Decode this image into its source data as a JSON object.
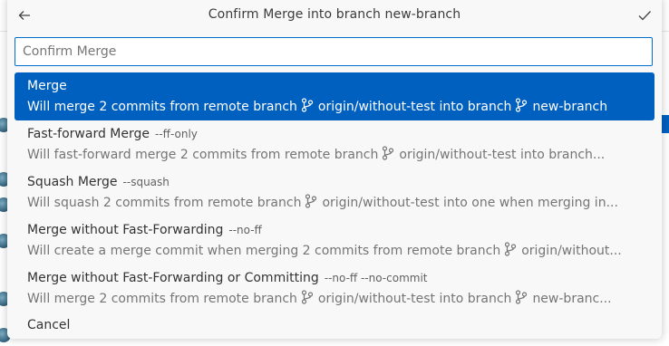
{
  "quick_pick": {
    "title": "Confirm Merge into branch new-branch",
    "back_icon": "arrow-left-icon",
    "ok_icon": "check-icon",
    "input": {
      "value": "",
      "placeholder": "Confirm Merge"
    },
    "items": [
      {
        "label": "Merge",
        "description": "",
        "detail": [
          "Will merge 2 commits from remote branch",
          "origin/without-test into branch",
          "new-branch"
        ]
      },
      {
        "label": "Fast-forward Merge",
        "description": "--ff-only",
        "detail": [
          "Will fast-forward merge 2 commits from remote branch",
          "origin/without-test into branch..."
        ]
      },
      {
        "label": "Squash Merge",
        "description": "--squash",
        "detail": [
          "Will squash 2 commits from remote branch",
          "origin/without-test into one when merging in..."
        ]
      },
      {
        "label": "Merge without Fast-Forwarding",
        "description": "--no-ff",
        "detail": [
          "Will create a merge commit when merging 2 commits from remote branch",
          "origin/without..."
        ]
      },
      {
        "label": "Merge without Fast-Forwarding or Committing",
        "description": "--no-ff --no-commit",
        "detail": [
          "Will merge 2 commits from remote branch",
          "origin/without-test into branch",
          "new-branc..."
        ]
      }
    ],
    "cancel_label": "Cancel"
  },
  "colors": {
    "accent": "#0060c0",
    "input_border": "#0070cf",
    "panel_bg": "#f8f8f8"
  }
}
